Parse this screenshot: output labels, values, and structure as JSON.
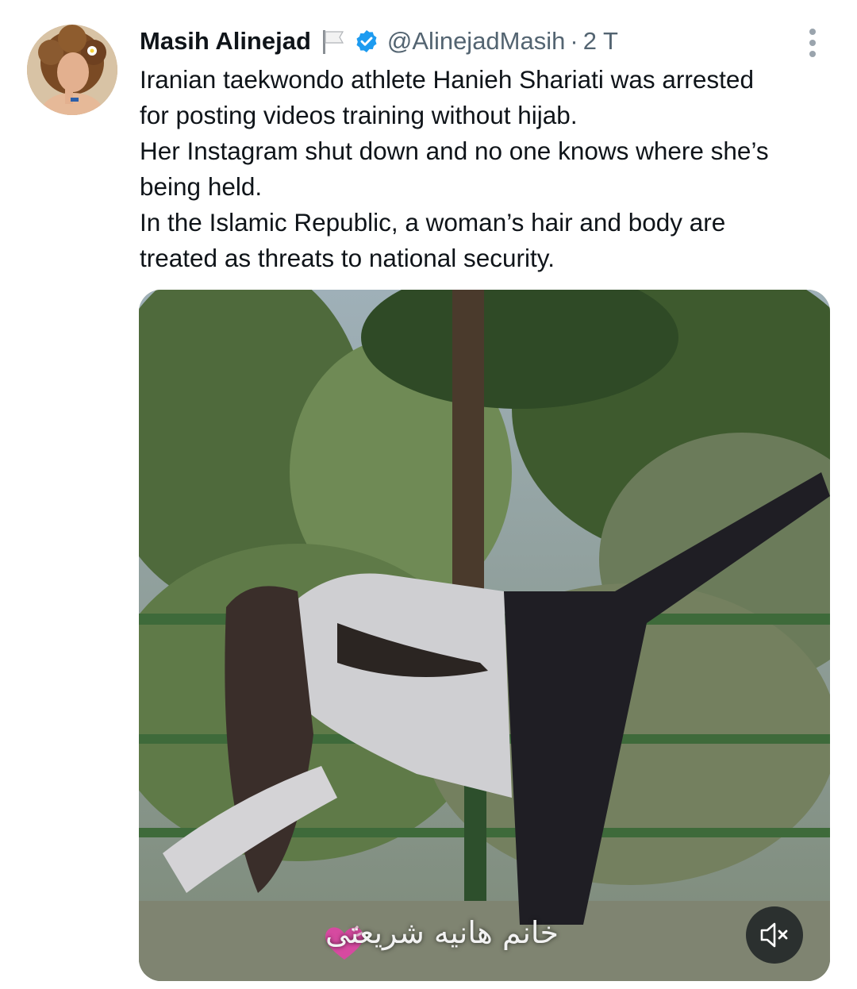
{
  "author": {
    "display_name": "Masih Alinejad",
    "handle": "@AlinejadMasih",
    "separator": "·",
    "time_ago": "2 T",
    "verified_color": "#1d9bf0"
  },
  "tweet": {
    "lines": [
      "Iranian taekwondo athlete Hanieh Shariati was arrested",
      "for posting videos training without hijab.",
      "Her Instagram shut down and no one knows where she’s",
      "being held.",
      "In the Islamic Republic, a woman’s hair and body are",
      "treated as threats to national security."
    ]
  },
  "media": {
    "caption": "خانم هانیه شریعتی",
    "mute_icon": "speaker-muted-icon"
  }
}
